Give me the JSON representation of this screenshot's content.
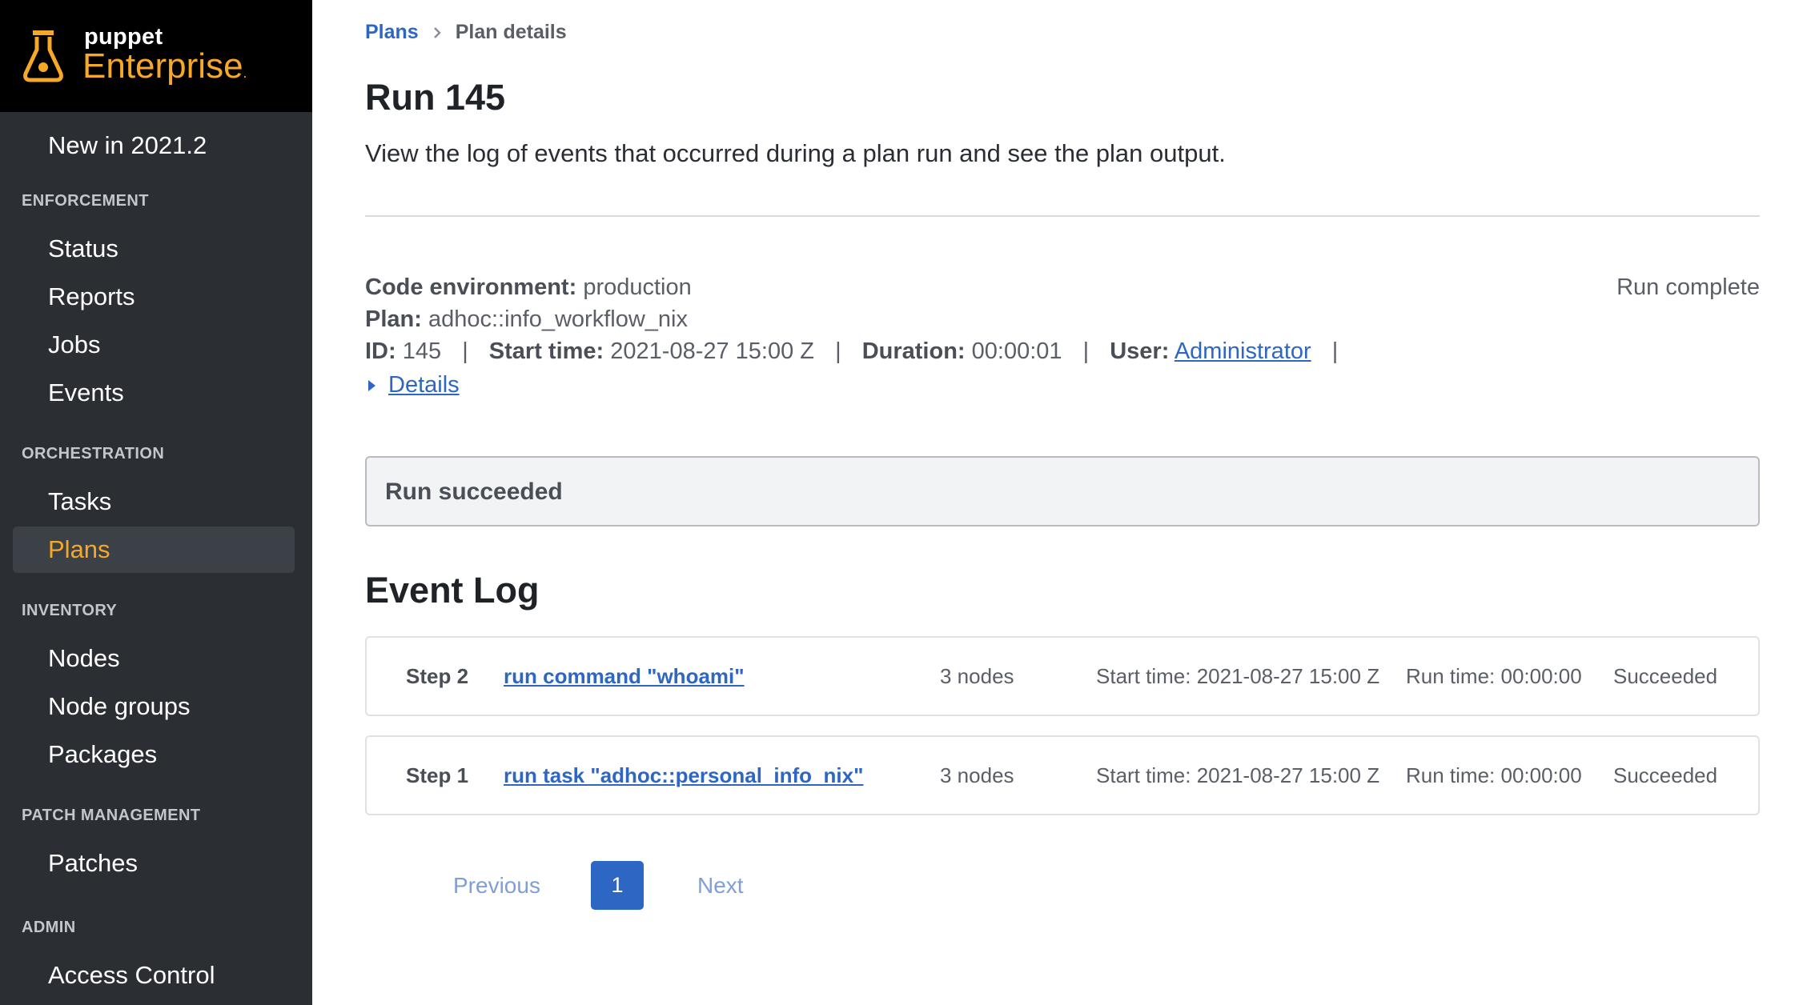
{
  "brand": {
    "line1": "puppet",
    "line2": "Enterprise",
    "accent_color": "#f6a829"
  },
  "sidebar": {
    "top_item": "New in 2021.2",
    "sections": [
      {
        "heading": "ENFORCEMENT",
        "items": [
          "Status",
          "Reports",
          "Jobs",
          "Events"
        ]
      },
      {
        "heading": "ORCHESTRATION",
        "items": [
          "Tasks",
          "Plans"
        ]
      },
      {
        "heading": "INVENTORY",
        "items": [
          "Nodes",
          "Node groups",
          "Packages"
        ]
      },
      {
        "heading": "PATCH MANAGEMENT",
        "items": [
          "Patches"
        ]
      },
      {
        "heading": "ADMIN",
        "items": [
          "Access Control"
        ]
      }
    ],
    "active_item": "Plans"
  },
  "breadcrumb": {
    "parent": "Plans",
    "current": "Plan details"
  },
  "page": {
    "title": "Run 145",
    "description": "View the log of events that occurred during a plan run and see the plan output."
  },
  "run": {
    "code_env_label": "Code environment:",
    "code_env": "production",
    "plan_label": "Plan:",
    "plan": "adhoc::info_workflow_nix",
    "id_label": "ID:",
    "id": "145",
    "start_label": "Start time:",
    "start": "2021-08-27 15:00 Z",
    "duration_label": "Duration:",
    "duration": "00:00:01",
    "user_label": "User:",
    "user": "Administrator",
    "separator": "|",
    "status": "Run complete",
    "details_label": "Details"
  },
  "alert": {
    "text": "Run succeeded"
  },
  "event_log": {
    "title": "Event Log",
    "steps": [
      {
        "step": "Step 2",
        "name": "run command \"whoami\"",
        "nodes": "3 nodes",
        "start": "Start time: 2021-08-27 15:00 Z",
        "run_time": "Run time: 00:00:00",
        "status": "Succeeded"
      },
      {
        "step": "Step 1",
        "name": "run task \"adhoc::personal_info_nix\"",
        "nodes": "3 nodes",
        "start": "Start time: 2021-08-27 15:00 Z",
        "run_time": "Run time: 00:00:00",
        "status": "Succeeded"
      }
    ]
  },
  "pagination": {
    "previous": "Previous",
    "current": "1",
    "next": "Next"
  }
}
